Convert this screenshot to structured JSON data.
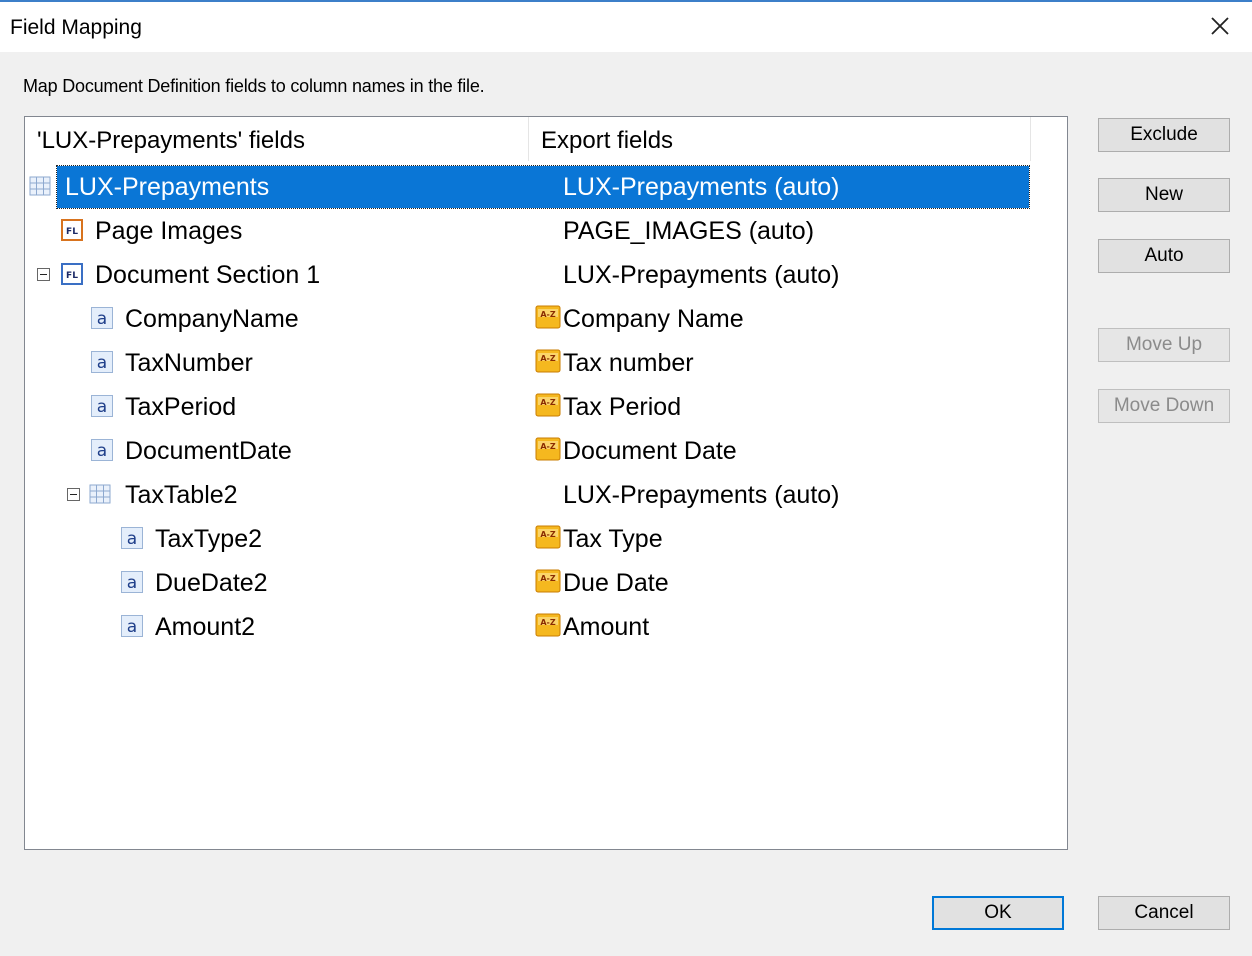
{
  "window": {
    "title": "Field Mapping"
  },
  "description": "Map Document Definition fields to column names in the file.",
  "columns": {
    "left": "'LUX-Prepayments' fields",
    "right": "Export fields"
  },
  "rows": [
    {
      "name": "LUX-Prepayments",
      "export": "LUX-Prepayments (auto)",
      "icon": "table-icon"
    },
    {
      "name": "Page Images",
      "export": "PAGE_IMAGES (auto)",
      "icon": "fl-icon"
    },
    {
      "name": "Document Section 1",
      "export": "LUX-Prepayments (auto)",
      "icon": "fl-icon"
    },
    {
      "name": "CompanyName",
      "export": "Company Name",
      "icon": "text-field-icon"
    },
    {
      "name": "TaxNumber",
      "export": "Tax number",
      "icon": "text-field-icon"
    },
    {
      "name": "TaxPeriod",
      "export": "Tax Period",
      "icon": "text-field-icon"
    },
    {
      "name": "DocumentDate",
      "export": "Document Date",
      "icon": "text-field-icon"
    },
    {
      "name": "TaxTable2",
      "export": "LUX-Prepayments (auto)",
      "icon": "table-icon"
    },
    {
      "name": "TaxType2",
      "export": "Tax Type",
      "icon": "text-field-icon"
    },
    {
      "name": "DueDate2",
      "export": "Due Date",
      "icon": "text-field-icon"
    },
    {
      "name": "Amount2",
      "export": "Amount",
      "icon": "text-field-icon"
    }
  ],
  "buttons": {
    "exclude": "Exclude",
    "new": "New",
    "auto": "Auto",
    "move_up": "Move Up",
    "move_down": "Move Down",
    "ok": "OK",
    "cancel": "Cancel"
  },
  "colors": {
    "selection": "#0a76d6",
    "accent": "#0078d7",
    "badge": "#f5a623"
  }
}
